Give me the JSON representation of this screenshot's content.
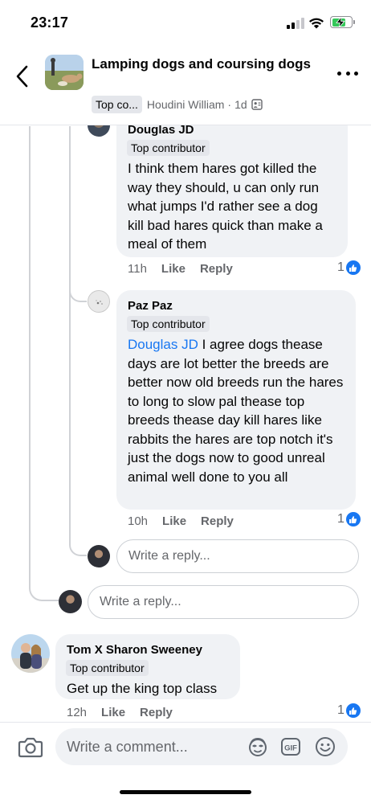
{
  "status_bar": {
    "time": "23:17"
  },
  "header": {
    "group_title": "Lamping dogs and coursing dogs",
    "badge": "Top co...",
    "author": "Houdini William",
    "separator": "·",
    "time": "1d"
  },
  "comments": {
    "douglas": {
      "name": "Douglas JD",
      "badge": "Top contributor",
      "text": "I think them hares got killed the way they should, u can only run what jumps I'd rather see a dog kill bad hares quick than make a meal of them",
      "time": "11h",
      "like_label": "Like",
      "reply_label": "Reply",
      "reactions": "1"
    },
    "paz": {
      "name": "Paz Paz",
      "badge": "Top contributor",
      "mention": "Douglas JD",
      "text": " I agree dogs thease days are lot better the breeds are better now old breeds run the hares to long to slow pal thease top breeds thease day kill hares like rabbits the hares are top notch it's just the dogs now to good unreal animal well done to you all",
      "time": "10h",
      "like_label": "Like",
      "reply_label": "Reply",
      "reactions": "1"
    },
    "tom": {
      "name": "Tom X Sharon Sweeney",
      "badge": "Top contributor",
      "text": "Get up the king top class",
      "time": "12h",
      "like_label": "Like",
      "reply_label": "Reply",
      "reactions": "1"
    }
  },
  "reply_inputs": {
    "nested_placeholder": "Write a reply...",
    "thread_placeholder": "Write a reply..."
  },
  "footer": {
    "comment_placeholder": "Write a comment..."
  },
  "colors": {
    "accent": "#1877f2",
    "bubble": "#f0f2f5",
    "secondary_text": "#65676b"
  }
}
